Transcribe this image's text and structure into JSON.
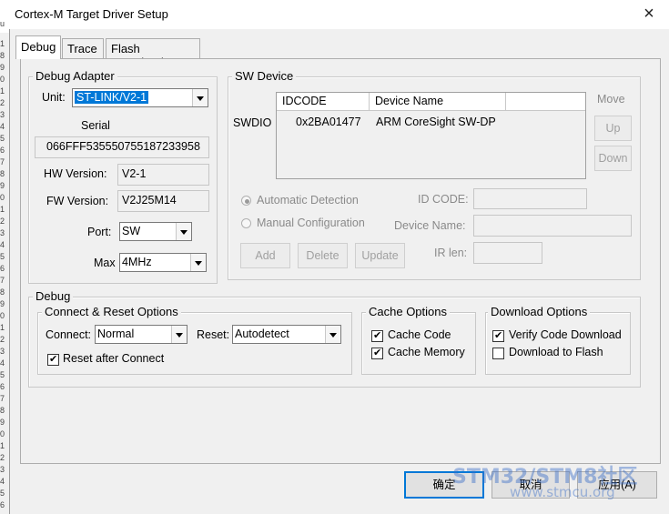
{
  "window": {
    "title": "Cortex-M Target Driver Setup",
    "close": "×"
  },
  "gutter": [
    "u",
    "1",
    "8",
    "9",
    "0",
    "1",
    "2",
    "3",
    "4",
    "5",
    "6",
    "7",
    "8",
    "9",
    "0",
    "1",
    "2",
    "3",
    "4",
    "5",
    "6",
    "7",
    "8",
    "9",
    "0",
    "1",
    "2",
    "3",
    "4",
    "5",
    "6",
    "7",
    "8",
    "9",
    "0",
    "1",
    "2",
    "3",
    "4",
    "5",
    "6"
  ],
  "tabs": [
    {
      "label": "Debug",
      "active": true
    },
    {
      "label": "Trace",
      "active": false
    },
    {
      "label": "Flash Download",
      "active": false
    }
  ],
  "debug_adapter": {
    "group_label": "Debug Adapter",
    "unit_label": "Unit:",
    "unit_value": "ST-LINK/V2-1",
    "serial_label": "Serial",
    "serial_value": "066FFF535550755187233958",
    "hw_label": "HW Version:",
    "hw_value": "V2-1",
    "fw_label": "FW Version:",
    "fw_value": "V2J25M14",
    "port_label": "Port:",
    "port_value": "SW",
    "max_label": "Max",
    "max_value": "4MHz"
  },
  "sw_device": {
    "group_label": "SW Device",
    "row_label": "SWDIO",
    "col_idcode": "IDCODE",
    "col_name": "Device Name",
    "rows": [
      {
        "idcode": "0x2BA01477",
        "name": "ARM CoreSight SW-DP"
      }
    ],
    "move_label": "Move",
    "up_label": "Up",
    "down_label": "Down",
    "auto_detect": "Automatic Detection",
    "manual_config": "Manual Configuration",
    "id_code_label": "ID CODE:",
    "device_name_label": "Device Name:",
    "ir_len_label": "IR len:",
    "add_label": "Add",
    "delete_label": "Delete",
    "update_label": "Update"
  },
  "debug": {
    "group_label": "Debug",
    "connect_reset": {
      "group_label": "Connect & Reset Options",
      "connect_label": "Connect:",
      "connect_value": "Normal",
      "reset_label": "Reset:",
      "reset_value": "Autodetect",
      "reset_after_connect": "Reset after Connect"
    },
    "cache": {
      "group_label": "Cache Options",
      "cache_code": "Cache Code",
      "cache_memory": "Cache Memory"
    },
    "download": {
      "group_label": "Download Options",
      "verify": "Verify Code Download",
      "download_flash": "Download to Flash"
    }
  },
  "buttons": {
    "ok": "确定",
    "cancel": "取消",
    "apply": "应用(A)"
  },
  "watermark": {
    "line1": "STM32/STM8社区",
    "line2": "www.stmcu.org"
  }
}
